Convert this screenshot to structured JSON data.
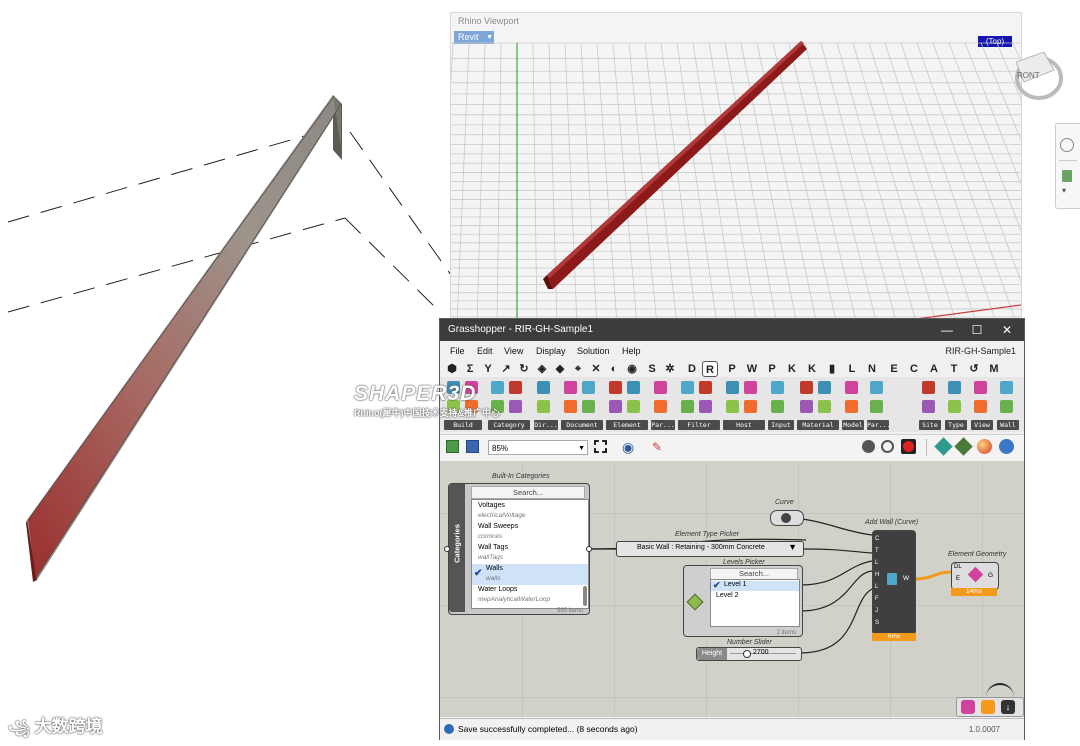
{
  "rhino": {
    "title": "Rhino Viewport",
    "view_tag": "Revit",
    "view_name": "(Top)",
    "navcube_label": "RONT"
  },
  "gh": {
    "window_title": "Grasshopper - RIR-GH-Sample1",
    "doc_title": "RIR-GH-Sample1",
    "menu": [
      "File",
      "Edit",
      "View",
      "Display",
      "Solution",
      "Help"
    ],
    "tab_letters": [
      "S",
      "D",
      "R",
      "P",
      "W",
      "P",
      "K",
      "K",
      "L",
      "N",
      "E",
      "C",
      "A",
      "T",
      "M"
    ],
    "ribbon_groups": [
      "Build",
      "Category",
      "Dir...",
      "Document",
      "Element",
      "Par...",
      "Filter",
      "Host",
      "Input",
      "Material",
      "Model",
      "Par...",
      "Site",
      "Type",
      "View",
      "Wall"
    ],
    "zoom": "85%",
    "status": "Save successfully completed... (8 seconds ago)",
    "version": "1.0.0007",
    "colors": {
      "title_bar": "#3c3c3c",
      "canvas": "#d2d1c9",
      "accent": "#f39a1d"
    },
    "nodes": {
      "builtin_categories": {
        "label": "Built-In Categories",
        "search": "Search...",
        "side_label": "Categories",
        "items": [
          {
            "name": "Voltages",
            "sub": "electricalVoltage"
          },
          {
            "name": "Wall Sweeps",
            "sub": "cornices"
          },
          {
            "name": "Wall Tags",
            "sub": "wallTags"
          },
          {
            "name": "Walls",
            "sub": "walls"
          },
          {
            "name": "Water Loops",
            "sub": "mepAnalyticalWaterLoop"
          }
        ],
        "count": "595 items"
      },
      "curve": {
        "label": "Curve"
      },
      "element_type_picker": {
        "label": "Element Type Picker",
        "value": "Basic Wall : Retaining - 300mm Concrete"
      },
      "levels_picker": {
        "label": "Levels Picker",
        "search": "Search...",
        "items": [
          "Level 1",
          "Level 2"
        ],
        "count": "2 items"
      },
      "add_wall": {
        "label": "Add Wall (Curve)",
        "inputs": [
          "C",
          "T",
          "L",
          "H",
          "L",
          "F",
          "J",
          "S"
        ],
        "output": "W",
        "time": "6ms"
      },
      "element_geometry": {
        "label": "Element Geometry",
        "inputs": [
          "DL",
          "E"
        ],
        "output": "G",
        "time": "14ms"
      },
      "number_slider": {
        "label": "Number Slider",
        "name": "Height",
        "value": "2700"
      }
    }
  },
  "watermarks": {
    "shaper_title": "SHAPER3D",
    "shaper_sub": "Rhino(犀牛)中国技术支持&推广中心",
    "bottom_brand": "大数跨境"
  }
}
